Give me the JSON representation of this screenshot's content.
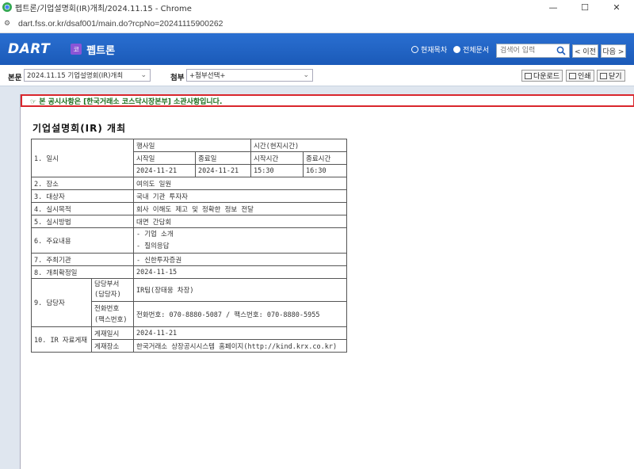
{
  "window": {
    "title": "펩트론/기업설명회(IR)개최/2024.11.15 - Chrome",
    "minimize": "—",
    "maximize": "☐",
    "close": "✕"
  },
  "address": {
    "url": "dart.fss.or.kr/dsaf001/main.do?rcpNo=20241115900262",
    "site_icon": "tune-icon"
  },
  "header": {
    "logo": "DART",
    "company_badge": "코",
    "company_name": "펩트론",
    "scope_current": "현재목차",
    "scope_all": "전체문서",
    "search_placeholder": "검색어 입력",
    "prev": "< 이전",
    "next": "다음 >"
  },
  "toolbar": {
    "body_label": "본문",
    "body_select": "2024.11.15 기업설명회(IR)개최",
    "attach_label": "첨부",
    "attach_select": "+첨부선택+",
    "download": "다운로드",
    "print": "인쇄",
    "close": "닫기"
  },
  "notice": "☞ 본 공시사항은 [한국거래소 코스닥시장본부] 소관사항입니다.",
  "doc_title": "기업설명회(IR) 개최",
  "table": {
    "r1": {
      "label": "1. 일시",
      "date_head": "행사일",
      "time_head": "시간(현지시간)",
      "start_date": "시작일",
      "end_date": "종료일",
      "start_time": "시작시간",
      "end_time": "종료시간",
      "start_date_v": "2024-11-21",
      "end_date_v": "2024-11-21",
      "start_time_v": "15:30",
      "end_time_v": "16:30"
    },
    "r2": {
      "label": "2. 장소",
      "value": "여의도 일원"
    },
    "r3": {
      "label": "3. 대상자",
      "value": "국내 기관 투자자"
    },
    "r4": {
      "label": "4. 실시목적",
      "value": "회사 이해도 제고 및 정확한 정보 전달"
    },
    "r5": {
      "label": "5. 실시방법",
      "value": "대면 간담회"
    },
    "r6": {
      "label": "6. 주요내용",
      "value1": "- 기업 소개",
      "value2": "- 질의응답"
    },
    "r7": {
      "label": "7. 주최기관",
      "value": "- 신한투자증권"
    },
    "r8": {
      "label": "8. 개최확정일",
      "value": "2024-11-15"
    },
    "r9": {
      "label": "9. 담당자",
      "dept_head1": "담당부서",
      "dept_head2": "(담당자)",
      "dept_value": "IR팀(장태웅 차장)",
      "phone_head1": "전화번호",
      "phone_head2": "(팩스번호)",
      "phone_value": "전화번호: 070-8880-5087 / 팩스번호: 070-8880-5955"
    },
    "r10": {
      "label": "10. IR 자료게재",
      "when_head": "게재일시",
      "when_value": "2024-11-21",
      "where_head": "게재장소",
      "where_value": "한국거래소 상장공시시스템 홈페이지(http://kind.krx.co.kr)"
    }
  }
}
